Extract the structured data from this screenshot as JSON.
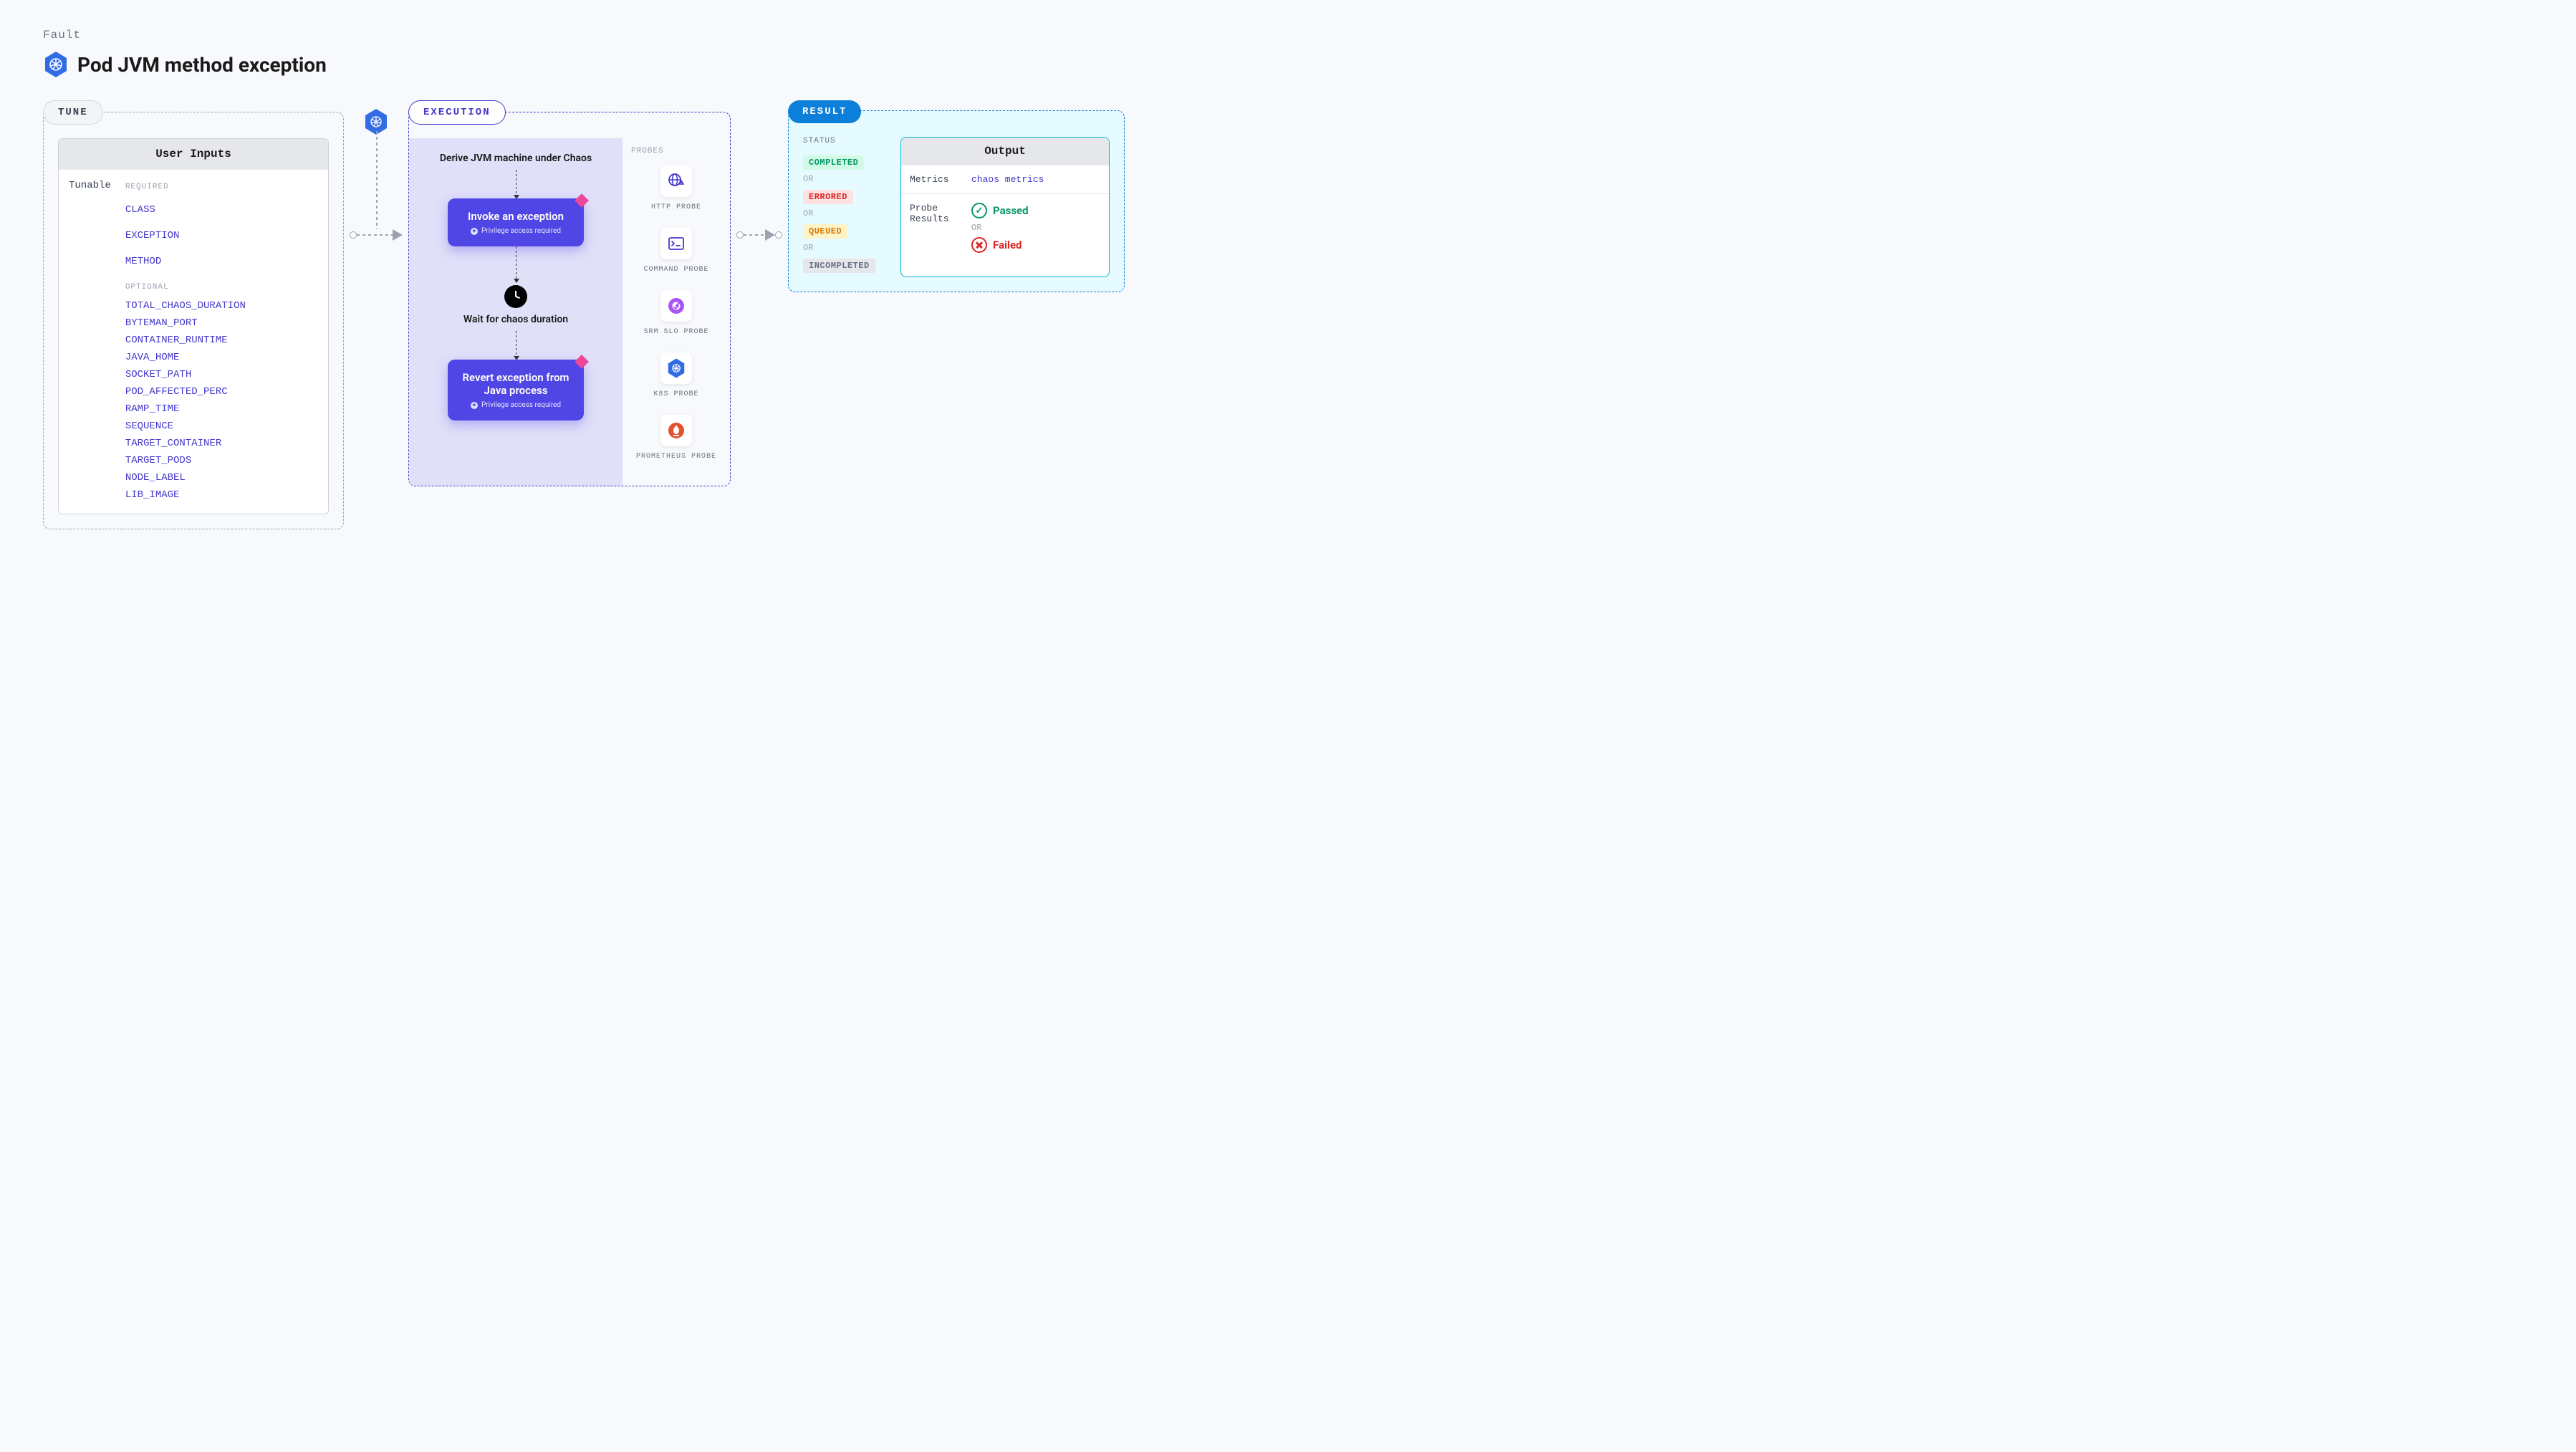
{
  "header": {
    "fault_label": "Fault",
    "title": "Pod JVM method exception"
  },
  "sections": {
    "tune_label": "TUNE",
    "execution_label": "EXECUTION",
    "result_label": "RESULT"
  },
  "tune": {
    "header": "User Inputs",
    "left_label": "Tunable",
    "required_label": "REQUIRED",
    "optional_label": "OPTIONAL",
    "required": [
      "CLASS",
      "EXCEPTION",
      "METHOD"
    ],
    "optional": [
      "TOTAL_CHAOS_DURATION",
      "BYTEMAN_PORT",
      "CONTAINER_RUNTIME",
      "JAVA_HOME",
      "SOCKET_PATH",
      "POD_AFFECTED_PERC",
      "RAMP_TIME",
      "SEQUENCE",
      "TARGET_CONTAINER",
      "TARGET_PODS",
      "NODE_LABEL",
      "LIB_IMAGE"
    ]
  },
  "execution": {
    "step1": "Derive JVM machine under Chaos",
    "card1_title": "Invoke an exception",
    "card_sub": "Privilege access required",
    "wait_text": "Wait for chaos duration",
    "card2_title": "Revert exception from Java process"
  },
  "probes": {
    "header": "PROBES",
    "items": [
      {
        "label": "HTTP PROBE",
        "icon": "globe"
      },
      {
        "label": "COMMAND PROBE",
        "icon": "terminal"
      },
      {
        "label": "SRM SLO PROBE",
        "icon": "gauge"
      },
      {
        "label": "K8S PROBE",
        "icon": "k8s"
      },
      {
        "label": "PROMETHEUS PROBE",
        "icon": "prometheus"
      }
    ]
  },
  "result": {
    "status_label": "STATUS",
    "statuses": [
      "COMPLETED",
      "ERRORED",
      "QUEUED",
      "INCOMPLETED"
    ],
    "or": "OR",
    "output_header": "Output",
    "metrics_label": "Metrics",
    "metrics_value": "chaos metrics",
    "probe_results_label": "Probe Results",
    "passed": "Passed",
    "failed": "Failed"
  }
}
